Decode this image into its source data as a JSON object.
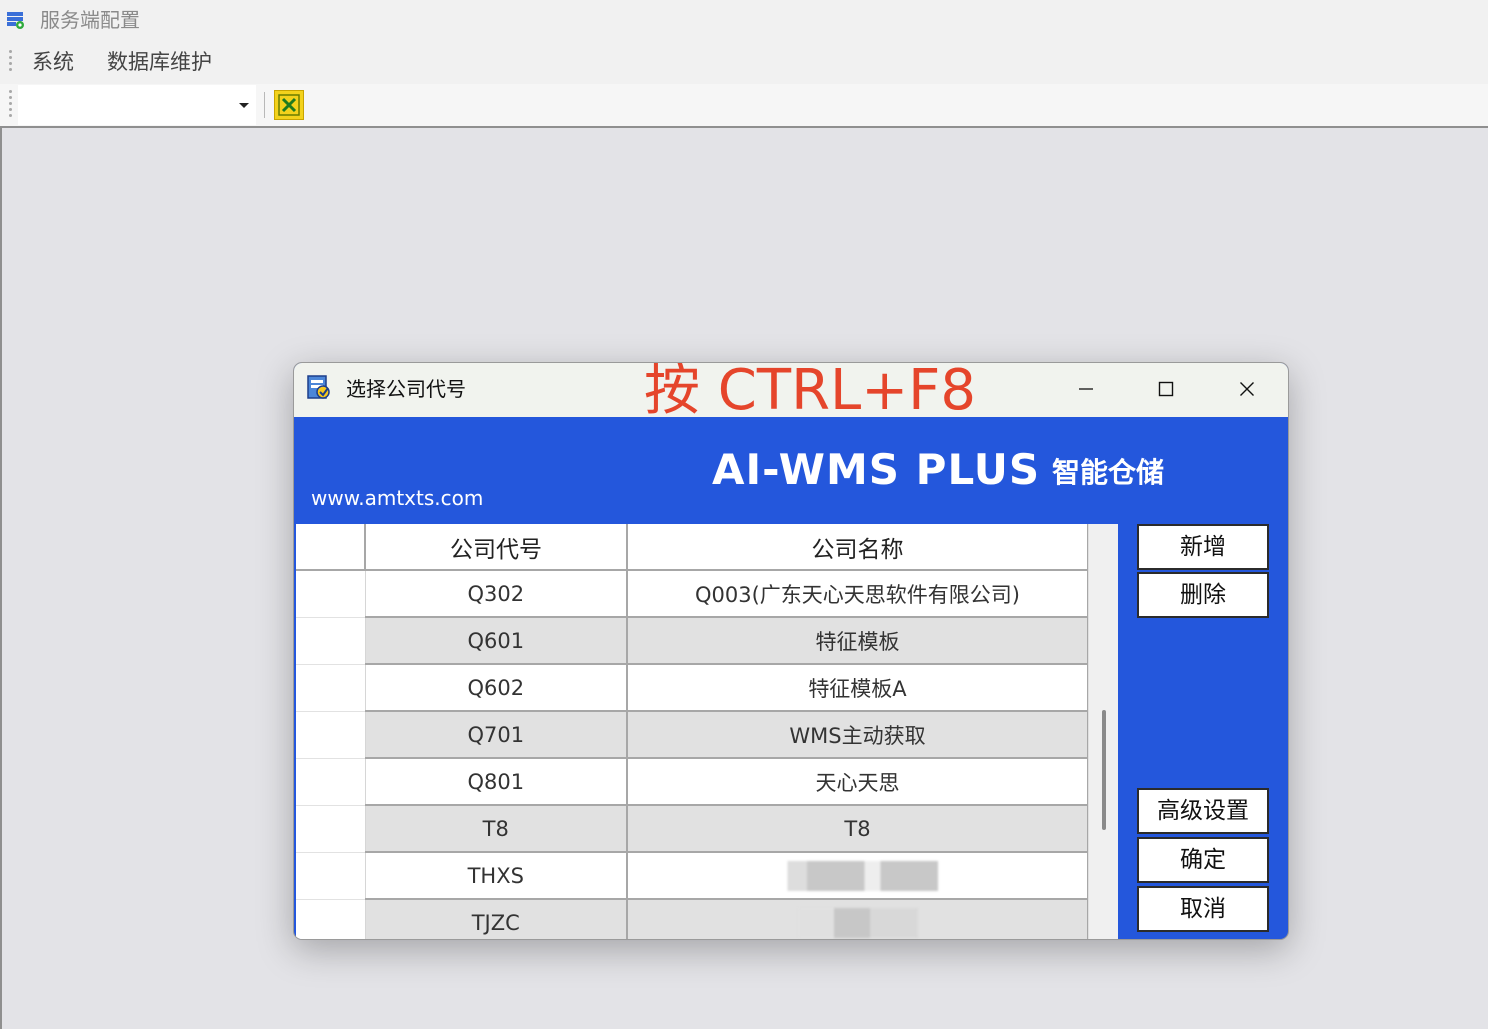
{
  "window": {
    "title": "服务端配置"
  },
  "menu": {
    "items": [
      "系统",
      "数据库维护"
    ]
  },
  "toolbar": {
    "combo_value": ""
  },
  "dialog": {
    "title": "选择公司代号",
    "hint_overlay": "按 CTRL+F8",
    "banner": {
      "url": "www.amtxts.com",
      "logo": "AI-WMS PLUS",
      "logo_cn": "智能仓储"
    },
    "table": {
      "columns": [
        "公司代号",
        "公司名称"
      ],
      "rows": [
        {
          "code": "Q302",
          "name": "Q003(广东天心天思软件有限公司)"
        },
        {
          "code": "Q601",
          "name": "特征模板"
        },
        {
          "code": "Q602",
          "name": "特征模板A"
        },
        {
          "code": "Q701",
          "name": "WMS主动获取"
        },
        {
          "code": "Q801",
          "name": "天心天思"
        },
        {
          "code": "T8",
          "name": "T8"
        },
        {
          "code": "THXS",
          "name": ""
        },
        {
          "code": "TJZC",
          "name": ""
        }
      ]
    },
    "buttons": {
      "add": "新增",
      "delete": "删除",
      "advanced": "高级设置",
      "ok": "确定",
      "cancel": "取消"
    }
  },
  "colors": {
    "banner_blue": "#2457dc",
    "hint_red": "#e5452b",
    "alt_row": "#e1e1e1",
    "toolbar_button_yellow": "#f3d21c"
  },
  "icons": [
    "app-window-icon",
    "close-x-icon",
    "dialog-app-icon",
    "minimize-icon",
    "maximize-icon",
    "close-icon",
    "dropdown-caret-icon"
  ]
}
